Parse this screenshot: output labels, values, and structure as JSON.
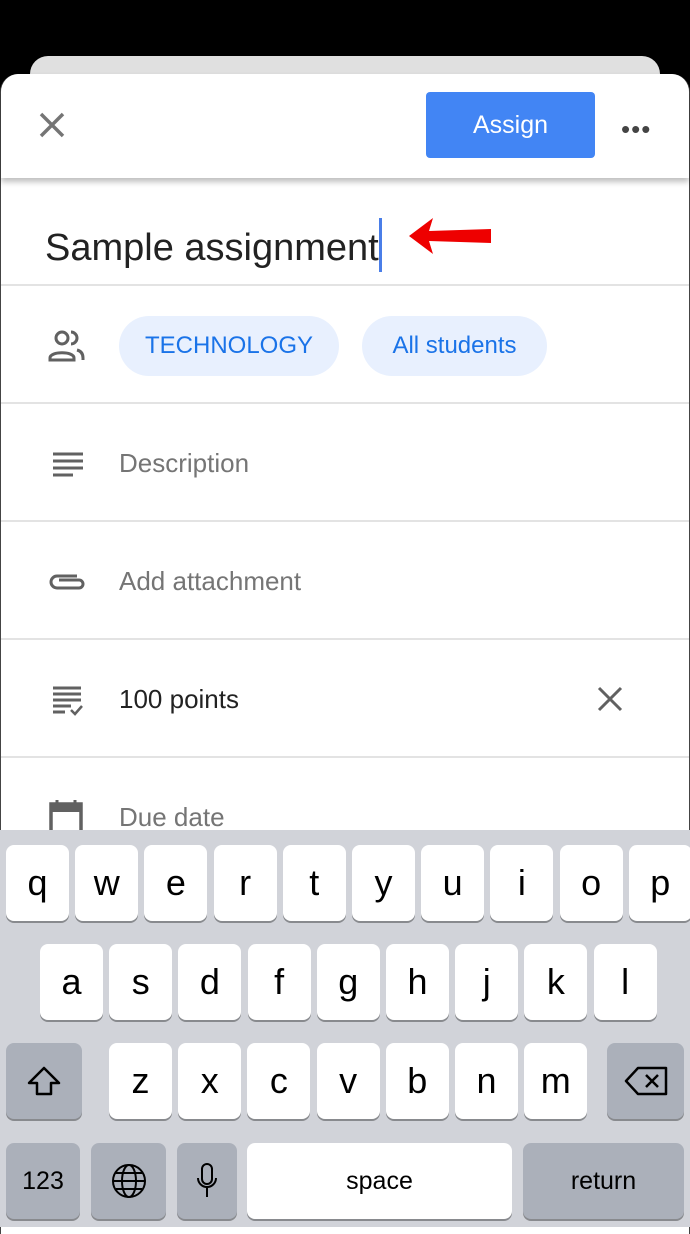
{
  "header": {
    "assign_label": "Assign",
    "more_icon": "more-horizontal-icon",
    "close_icon": "close-icon"
  },
  "title": {
    "value": "Sample assignment"
  },
  "audience": {
    "class_chip": "TECHNOLOGY",
    "students_chip": "All students"
  },
  "fields": {
    "description_placeholder": "Description",
    "attachment_label": "Add attachment",
    "points_value": "100 points",
    "due_date_label": "Due date"
  },
  "colors": {
    "accent": "#4285f4",
    "chip_bg": "#e8f0fe",
    "chip_text": "#1a73e8",
    "annotation_arrow": "#ee0000"
  },
  "keyboard": {
    "row1": [
      "q",
      "w",
      "e",
      "r",
      "t",
      "y",
      "u",
      "i",
      "o",
      "p"
    ],
    "row2": [
      "a",
      "s",
      "d",
      "f",
      "g",
      "h",
      "j",
      "k",
      "l"
    ],
    "row3": [
      "z",
      "x",
      "c",
      "v",
      "b",
      "n",
      "m"
    ],
    "numbers": "123",
    "space": "space",
    "return": "return"
  }
}
